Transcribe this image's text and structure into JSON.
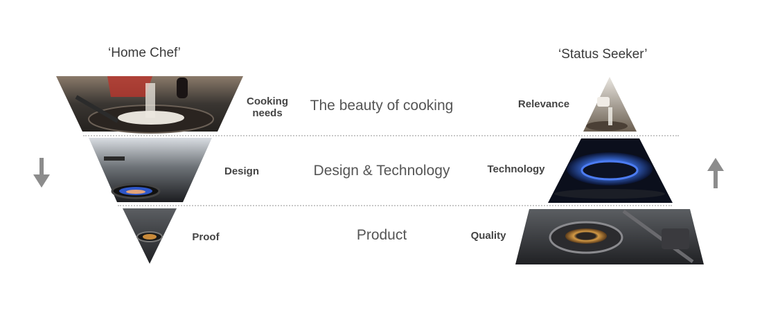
{
  "personas": {
    "left": "‘Home Chef’",
    "right": "‘Status Seeker’"
  },
  "left_levels": [
    {
      "label": "Cooking\nneeds"
    },
    {
      "label": "Design"
    },
    {
      "label": "Proof"
    }
  ],
  "center_levels": [
    {
      "label": "The beauty of cooking"
    },
    {
      "label": "Design & Technology"
    },
    {
      "label": "Product"
    }
  ],
  "right_levels": [
    {
      "label": "Relevance"
    },
    {
      "label": "Technology"
    },
    {
      "label": "Quality"
    }
  ],
  "arrows": {
    "left": "down-arrow-icon",
    "right": "up-arrow-icon"
  }
}
